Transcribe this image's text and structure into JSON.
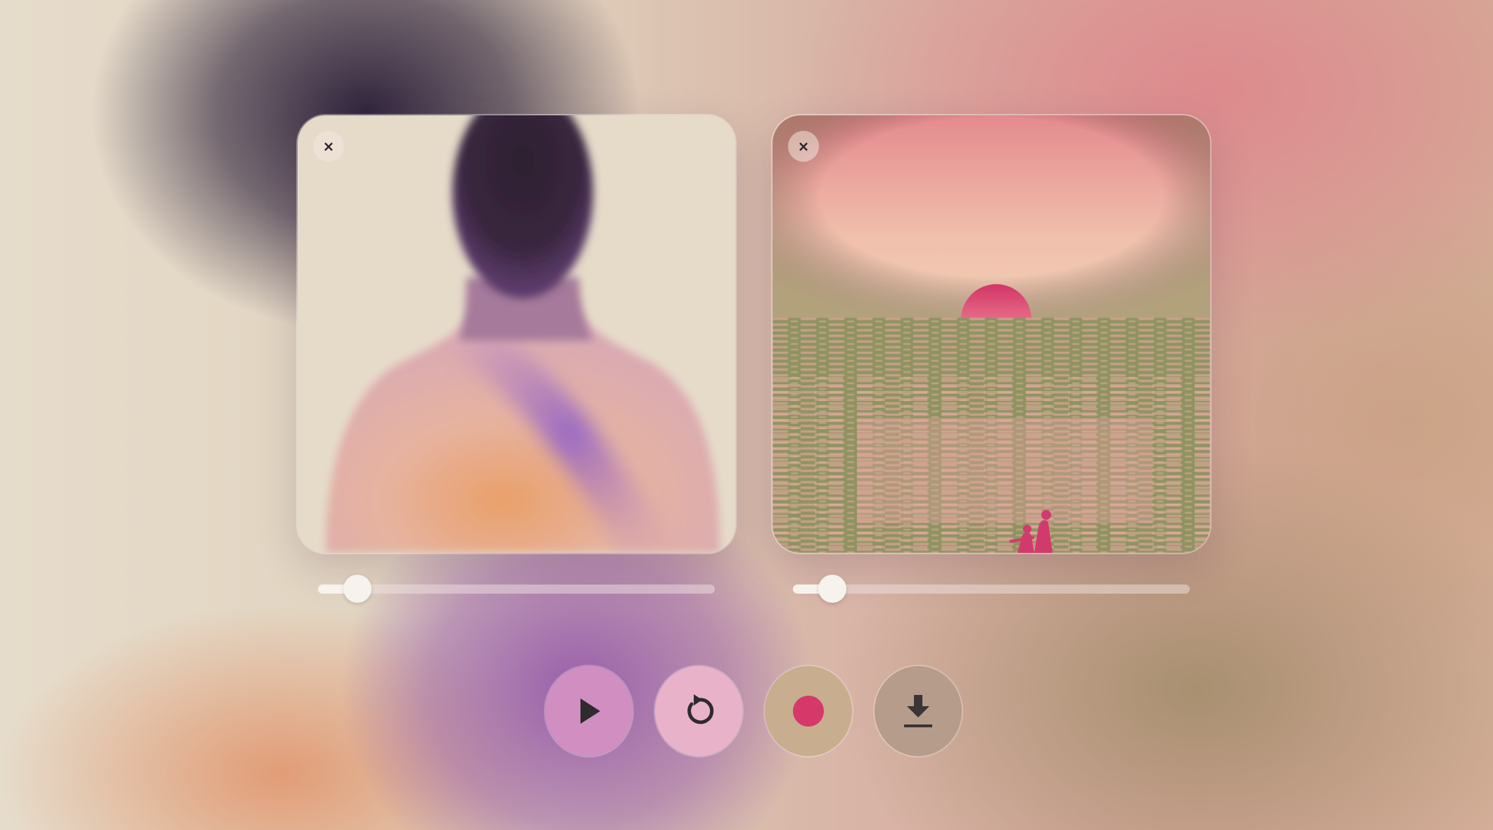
{
  "left_card": {
    "close_label": "×",
    "icon": "close-icon",
    "slider_value": 0.1
  },
  "right_card": {
    "close_label": "×",
    "icon": "close-icon",
    "slider_value": 0.1
  },
  "controls": {
    "play_icon": "play-icon",
    "reset_icon": "reset-icon",
    "record_icon": "record-icon",
    "download_icon": "download-icon",
    "record_color": "#d6386a"
  },
  "colors": {
    "play_bg": "#d18ec0",
    "reset_bg": "#e8b3c8",
    "record_bg": "#c8ad8e",
    "download_bg": "#b69c8a",
    "icon_color": "#2e2a2e"
  }
}
